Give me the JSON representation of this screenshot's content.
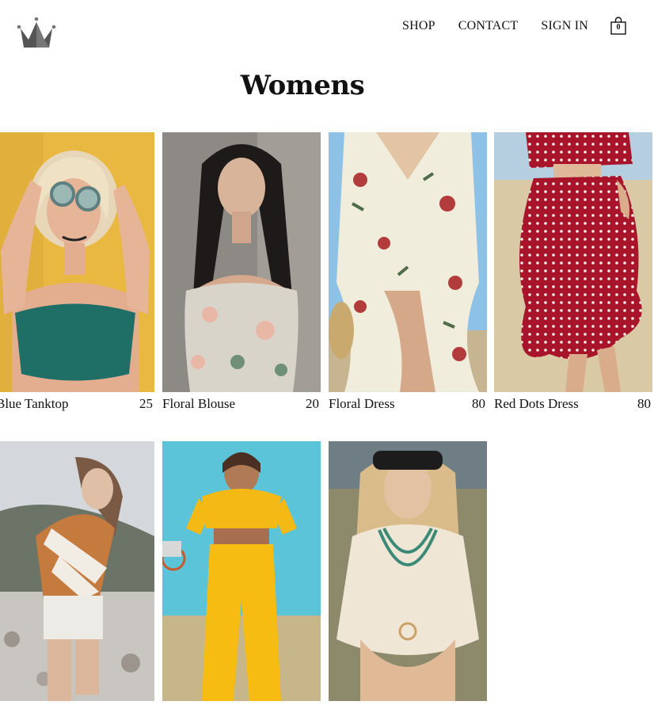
{
  "header": {
    "logo": "crown-icon",
    "nav": {
      "shop": "SHOP",
      "contact": "CONTACT",
      "sign_in": "SIGN IN"
    },
    "cart": {
      "icon": "shopping-bag-icon",
      "count": "0"
    }
  },
  "page": {
    "title": "Womens"
  },
  "products": [
    {
      "name": "Blue Tanktop",
      "price": "25"
    },
    {
      "name": "Floral Blouse",
      "price": "20"
    },
    {
      "name": "Floral Dress",
      "price": "80"
    },
    {
      "name": "Red Dots Dress",
      "price": "80"
    },
    {
      "name": "",
      "price": ""
    },
    {
      "name": "",
      "price": ""
    },
    {
      "name": "",
      "price": ""
    }
  ]
}
